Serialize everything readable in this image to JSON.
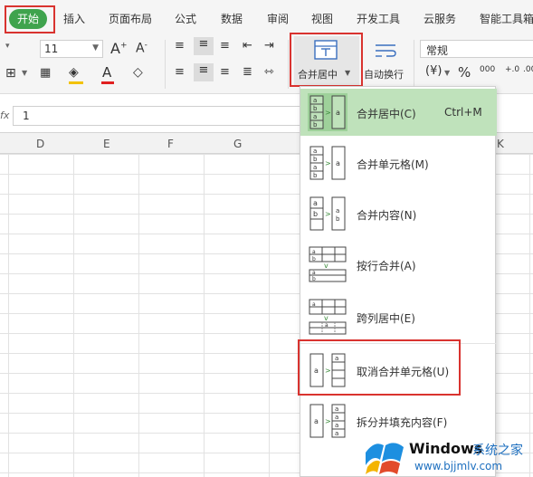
{
  "tabs": [
    {
      "label": "开始",
      "active": true
    },
    {
      "label": "插入"
    },
    {
      "label": "页面布局"
    },
    {
      "label": "公式"
    },
    {
      "label": "数据"
    },
    {
      "label": "审阅"
    },
    {
      "label": "视图"
    },
    {
      "label": "开发工具"
    },
    {
      "label": "云服务"
    },
    {
      "label": "智能工具箱"
    }
  ],
  "ribbon": {
    "font_size": "11",
    "number_format": "常规",
    "merge_label": "合并居中",
    "wrap_label": "自动换行",
    "currency_symbol": "¥",
    "percent_symbol": "%",
    "thousands_symbol": "000",
    "decimal_inc": "+.0",
    "decimal_dec": ".00"
  },
  "formula_bar": {
    "fx_label": "fx",
    "value": "1"
  },
  "columns": [
    "D",
    "E",
    "F",
    "G",
    "K"
  ],
  "merge_menu": {
    "items": [
      {
        "label": "合并居中(C)",
        "shortcut": "Ctrl+M",
        "highlighted": true,
        "icon": "merge-center-icon"
      },
      {
        "label": "合并单元格(M)",
        "icon": "merge-cells-icon"
      },
      {
        "label": "合并内容(N)",
        "icon": "merge-content-icon"
      },
      {
        "label": "按行合并(A)",
        "icon": "merge-by-row-icon"
      },
      {
        "label": "跨列居中(E)",
        "icon": "center-across-icon"
      },
      {
        "label": "取消合并单元格(U)",
        "icon": "unmerge-cells-icon",
        "boxed": true
      },
      {
        "label": "拆分并填充内容(F)",
        "icon": "split-fill-icon"
      }
    ]
  },
  "watermark": {
    "brand": "Windows",
    "brand_cn": "系统之家",
    "url": "www.bjjmlv.com"
  },
  "colors": {
    "accent_green": "#3fa34d",
    "highlight_green": "#bfe2bb",
    "red_box": "#d9332f"
  }
}
